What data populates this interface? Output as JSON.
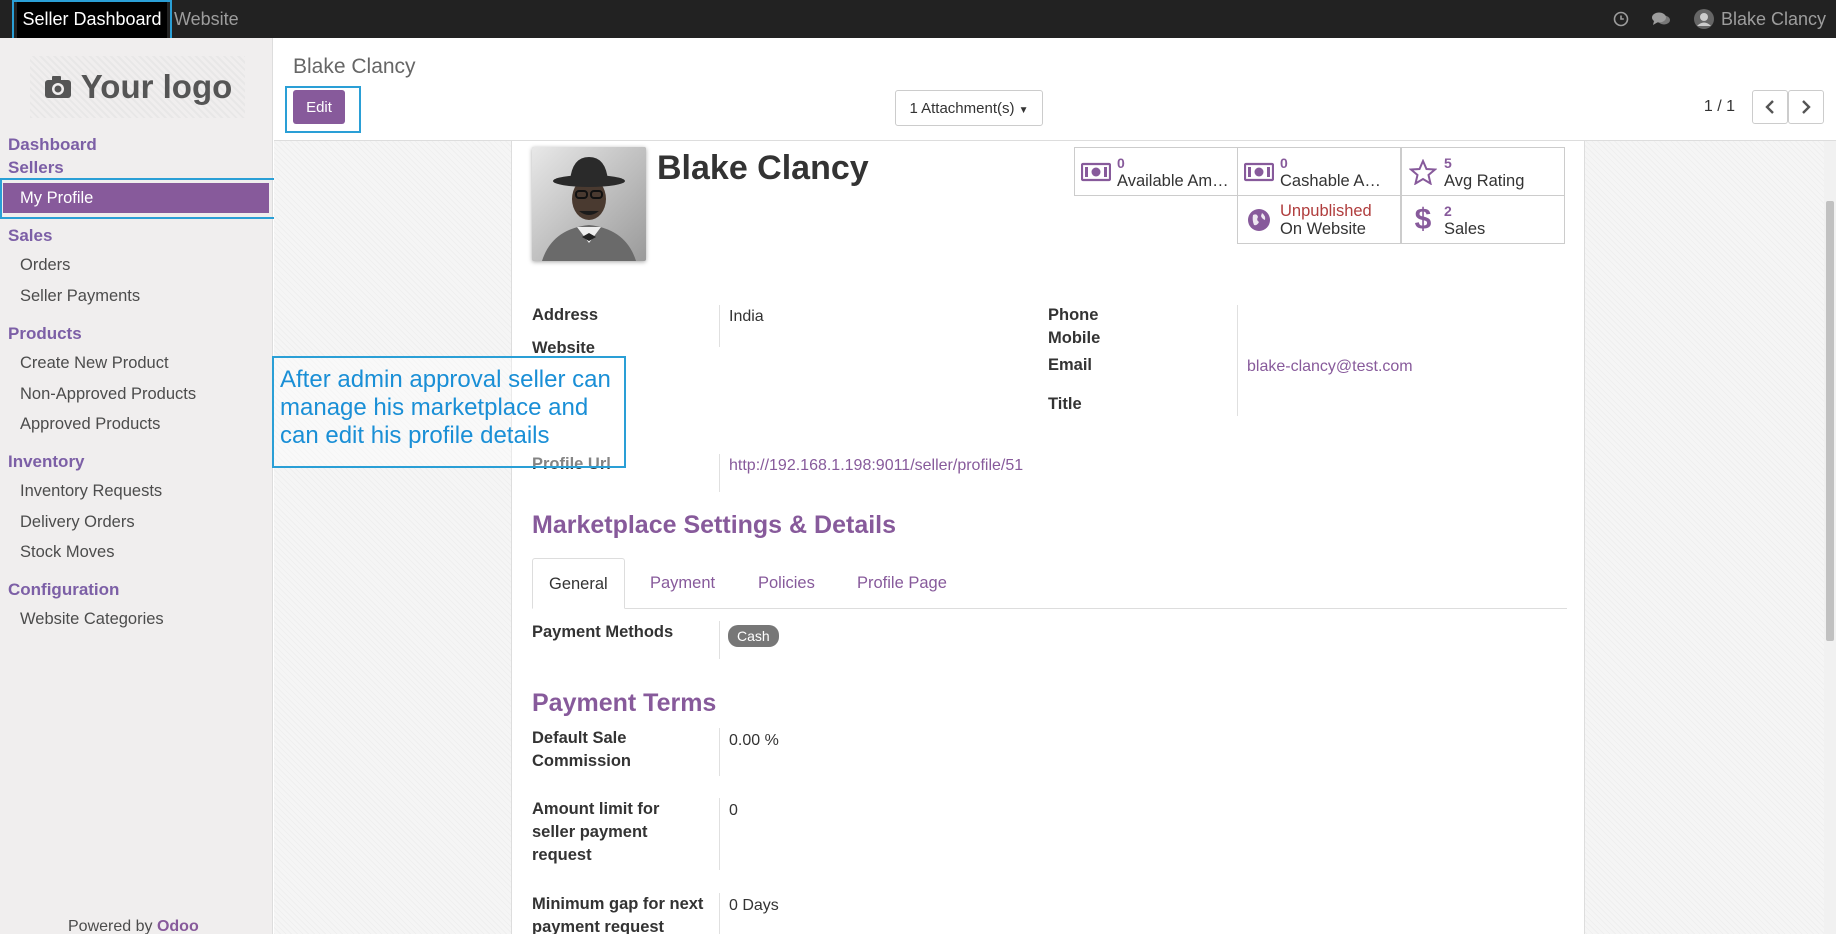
{
  "topbar": {
    "menu_seller": "Seller Dashboard",
    "menu_website": "Website",
    "user_name": "Blake Clancy"
  },
  "sidebar": {
    "logo_text": "Your logo",
    "dashboard": "Dashboard",
    "sellers": "Sellers",
    "my_profile": "My Profile",
    "sales": "Sales",
    "orders": "Orders",
    "seller_payments": "Seller Payments",
    "products": "Products",
    "create_new_product": "Create New Product",
    "non_approved_products": "Non-Approved Products",
    "approved_products": "Approved Products",
    "inventory": "Inventory",
    "inventory_requests": "Inventory Requests",
    "delivery_orders": "Delivery Orders",
    "stock_moves": "Stock Moves",
    "configuration": "Configuration",
    "website_categories": "Website Categories",
    "powered_by": "Powered by",
    "odoo": "Odoo"
  },
  "control_panel": {
    "breadcrumb": "Blake Clancy",
    "edit_label": "Edit",
    "attachments_label": "1 Attachment(s)",
    "pager": "1 / 1"
  },
  "profile": {
    "name": "Blake Clancy",
    "stats": {
      "available_amount": "0",
      "available_amount_label": "Available Am…",
      "cashable_amount": "0",
      "cashable_amount_label": "Cashable A…",
      "avg_rating": "5",
      "avg_rating_label": "Avg Rating",
      "published_status": "Unpublished",
      "published_label": "On Website",
      "sales_count": "2",
      "sales_label": "Sales"
    },
    "address_label": "Address",
    "address_value": "India",
    "website_label": "Website",
    "phone_label": "Phone",
    "mobile_label": "Mobile",
    "email_label": "Email",
    "email_value": "blake-clancy@test.com",
    "title_label": "Title",
    "profile_url_label": "Profile Url",
    "profile_url_value": "http://192.168.1.198:9011/seller/profile/51"
  },
  "marketplace": {
    "section_title": "Marketplace Settings & Details",
    "tabs": [
      "General",
      "Payment",
      "Policies",
      "Profile Page"
    ],
    "payment_methods_label": "Payment Methods",
    "payment_method_tag": "Cash",
    "payment_terms_title": "Payment Terms",
    "default_commission_label_1": "Default Sale",
    "default_commission_label_2": "Commission",
    "default_commission_value": "0.00 %",
    "amount_limit_label_1": "Amount limit for",
    "amount_limit_label_2": "seller payment",
    "amount_limit_label_3": "request",
    "amount_limit_value": "0",
    "min_gap_label_1": "Minimum gap for next",
    "min_gap_label_2": "payment request",
    "min_gap_value": "0 Days"
  },
  "annotation": {
    "line1": "After admin approval seller can",
    "line2": "manage his marketplace and",
    "line3": "can edit his profile details"
  },
  "colors": {
    "accent": "#875a9b",
    "annotation": "#2a9fd6",
    "unpublished": "#b03d3d"
  }
}
